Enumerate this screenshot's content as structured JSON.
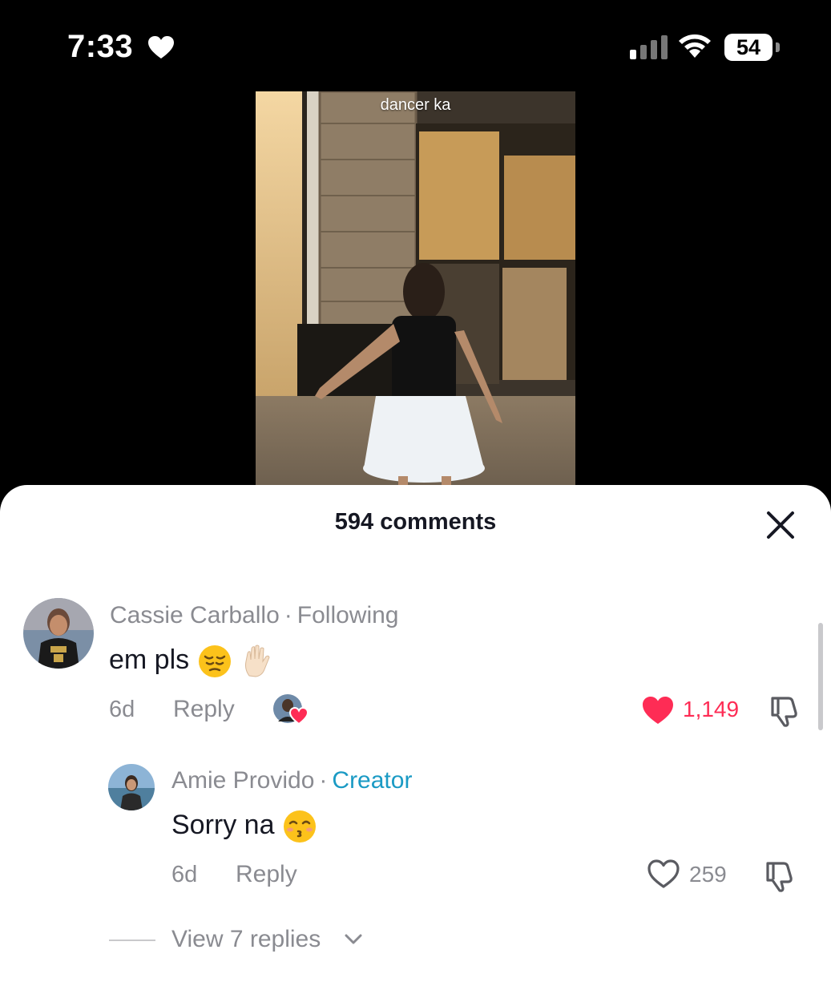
{
  "status_bar": {
    "time": "7:33",
    "battery": "54"
  },
  "video": {
    "caption": "dancer ka"
  },
  "comments_sheet": {
    "title": "594 comments",
    "comments": [
      {
        "username": "Cassie Carballo",
        "separator": "·",
        "relationship": "Following",
        "text": "em pls",
        "emojis": [
          "pensive-face",
          "raised-hand"
        ],
        "age": "6d",
        "reply_label": "Reply",
        "likes": "1,149",
        "liked": true,
        "liked_by_creator": true
      },
      {
        "username": "Amie Provido",
        "separator": "·",
        "badge": "Creator",
        "text": "Sorry na",
        "emojis": [
          "kissing-face-closed-eyes"
        ],
        "age": "6d",
        "reply_label": "Reply",
        "likes": "259",
        "liked": false
      }
    ],
    "view_replies": "View 7 replies"
  },
  "colors": {
    "like_red": "#fe2c55",
    "creator_blue": "#1a9ac4",
    "muted_gray": "#8a8b91"
  }
}
